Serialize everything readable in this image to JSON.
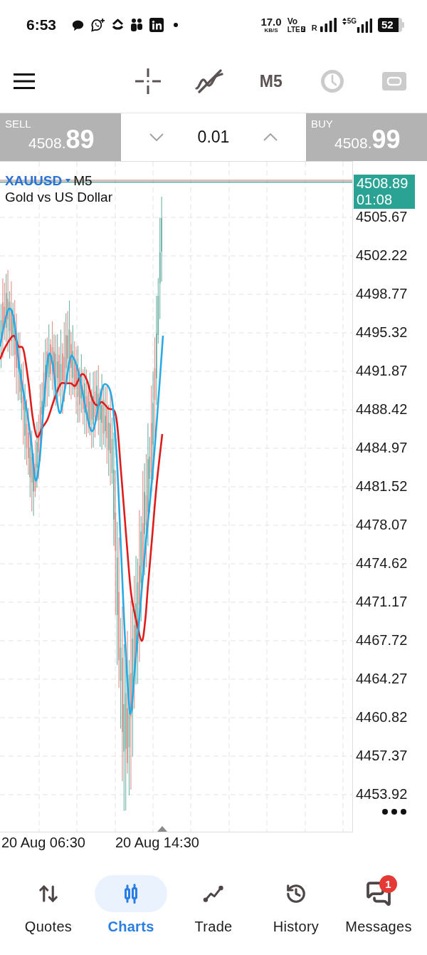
{
  "status_bar": {
    "time": "6:53",
    "data_rate": "17.0",
    "data_rate_unit": "KB/S",
    "volte": "Vo",
    "lte": "LTE",
    "sim_slot": "2",
    "roaming": "R",
    "network_type": "5G",
    "battery": "52"
  },
  "toolbar": {
    "tools": [
      {
        "kind": "crosshair",
        "disabled": false
      },
      {
        "kind": "indicators",
        "disabled": false
      },
      {
        "kind": "timeframe",
        "label": "M5",
        "disabled": false
      },
      {
        "kind": "clock",
        "disabled": true
      },
      {
        "kind": "one_click",
        "disabled": true
      }
    ]
  },
  "trade_bar": {
    "sell": {
      "label": "SELL",
      "price": "4508.",
      "price_pips": "89"
    },
    "volume": "0.01",
    "buy": {
      "label": "BUY",
      "price": "4508.",
      "price_pips": "99"
    }
  },
  "chart": {
    "symbol": "XAUUSD",
    "timeframe": "M5",
    "description": "Gold vs US Dollar",
    "current_price": "4508.89",
    "bar_countdown": "01:08",
    "price_scale": [
      "4505.67",
      "4502.22",
      "4498.77",
      "4495.32",
      "4491.87",
      "4488.42",
      "4484.97",
      "4481.52",
      "4478.07",
      "4474.62",
      "4471.17",
      "4467.72",
      "4464.27",
      "4460.82",
      "4457.37",
      "4453.92"
    ],
    "time_scale": [
      "20 Aug 06:30",
      "20 Aug 14:30"
    ]
  },
  "bottom_nav": [
    {
      "kind": "arrows",
      "label": "Quotes",
      "selected": false
    },
    {
      "kind": "candles",
      "label": "Charts",
      "selected": true
    },
    {
      "kind": "line",
      "label": "Trade",
      "selected": false
    },
    {
      "kind": "history",
      "label": "History",
      "selected": false
    },
    {
      "kind": "chat",
      "label": "Messages",
      "selected": false,
      "badge": "1"
    }
  ]
}
